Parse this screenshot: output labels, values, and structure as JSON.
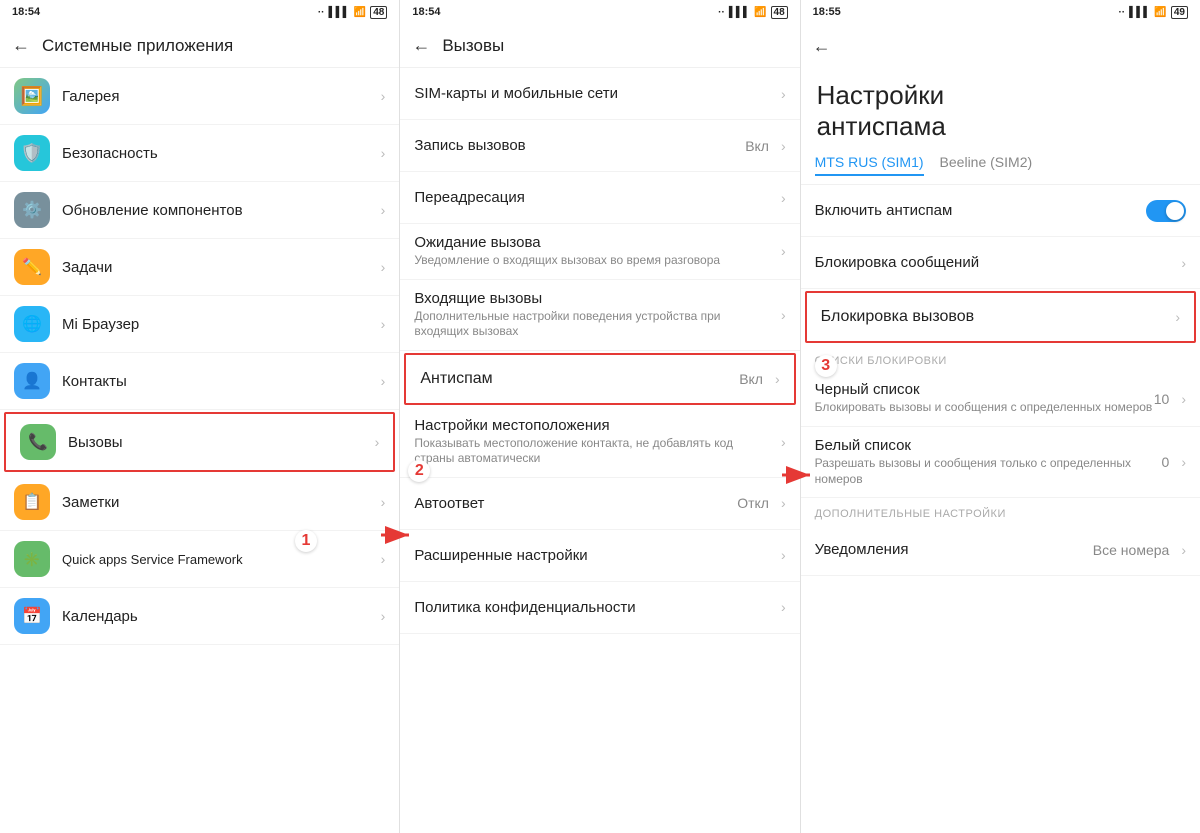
{
  "screens": [
    {
      "statusBar": {
        "time": "18:54",
        "dots": "··"
      },
      "navTitle": "Системные приложения",
      "items": [
        {
          "id": "gallery",
          "icon": "🖼️",
          "iconBg": "#e8f5e9",
          "title": "Галерея",
          "subtitle": "",
          "value": "",
          "chevron": true
        },
        {
          "id": "security",
          "icon": "🛡️",
          "iconBg": "#e3f2fd",
          "title": "Безопасность",
          "subtitle": "",
          "value": "",
          "chevron": true
        },
        {
          "id": "updater",
          "icon": "⚙️",
          "iconBg": "#fff3e0",
          "title": "Обновление компонентов",
          "subtitle": "",
          "value": "",
          "chevron": true
        },
        {
          "id": "tasks",
          "icon": "✏️",
          "iconBg": "#fff8e1",
          "title": "Задачи",
          "subtitle": "",
          "value": "",
          "chevron": true
        },
        {
          "id": "browser",
          "icon": "🌐",
          "iconBg": "#e3f2fd",
          "title": "Mi Браузер",
          "subtitle": "",
          "value": "",
          "chevron": true
        },
        {
          "id": "contacts",
          "icon": "👤",
          "iconBg": "#e8f5e9",
          "title": "Контакты",
          "subtitle": "",
          "value": "",
          "chevron": true
        },
        {
          "id": "calls",
          "icon": "📞",
          "iconBg": "#e8f5e9",
          "title": "Вызовы",
          "subtitle": "",
          "value": "",
          "chevron": true,
          "highlighted": true
        },
        {
          "id": "notes",
          "icon": "📋",
          "iconBg": "#fff8e1",
          "title": "Заметки",
          "subtitle": "",
          "value": "",
          "chevron": true
        },
        {
          "id": "quickapps",
          "icon": "✳️",
          "iconBg": "#e8f5e9",
          "title": "Quick apps Service Framework",
          "subtitle": "",
          "value": "",
          "chevron": true
        },
        {
          "id": "calendar",
          "icon": "📅",
          "iconBg": "#e3f2fd",
          "title": "Календарь",
          "subtitle": "",
          "value": "",
          "chevron": true
        }
      ],
      "annotation": "1"
    },
    {
      "statusBar": {
        "time": "18:54",
        "dots": "··"
      },
      "navTitle": "Вызовы",
      "items": [
        {
          "id": "sim",
          "icon": "",
          "title": "SIM-карты и мобильные сети",
          "subtitle": "",
          "value": "",
          "chevron": true
        },
        {
          "id": "record",
          "icon": "",
          "title": "Запись вызовов",
          "subtitle": "",
          "value": "Вкл",
          "chevron": true
        },
        {
          "id": "redirect",
          "icon": "",
          "title": "Переадресация",
          "subtitle": "",
          "value": "",
          "chevron": true
        },
        {
          "id": "wait",
          "icon": "",
          "title": "Ожидание вызова",
          "subtitle": "Уведомление о входящих вызовах во время разговора",
          "value": "",
          "chevron": true
        },
        {
          "id": "incoming",
          "icon": "",
          "title": "Входящие вызовы",
          "subtitle": "Дополнительные настройки поведения устройства при входящих вызовах",
          "value": "",
          "chevron": true
        },
        {
          "id": "antispam",
          "icon": "",
          "title": "Антиспам",
          "subtitle": "",
          "value": "Вкл",
          "chevron": true,
          "highlighted": true
        },
        {
          "id": "location",
          "icon": "",
          "title": "Настройки местоположения",
          "subtitle": "Показывать местоположение контакта, не добавлять код страны автоматически",
          "value": "",
          "chevron": true
        },
        {
          "id": "autoanswer",
          "icon": "",
          "title": "Автоответ",
          "subtitle": "",
          "value": "Откл",
          "chevron": true
        },
        {
          "id": "advanced",
          "icon": "",
          "title": "Расширенные настройки",
          "subtitle": "",
          "value": "",
          "chevron": true
        },
        {
          "id": "privacy",
          "icon": "",
          "title": "Политика конфиденциальности",
          "subtitle": "",
          "value": "",
          "chevron": true
        }
      ],
      "annotation": "2"
    },
    {
      "statusBar": {
        "time": "18:55",
        "dots": "··"
      },
      "navTitle": "",
      "largeTitle": "Настройки\nантиспама",
      "simTabs": [
        {
          "label": "MTS RUS (SIM1)",
          "active": true
        },
        {
          "label": "Beeline (SIM2)",
          "active": false
        }
      ],
      "items": [
        {
          "id": "enable-antispam",
          "title": "Включить антиспам",
          "toggle": true
        },
        {
          "id": "block-messages",
          "title": "Блокировка сообщений",
          "chevron": true
        },
        {
          "id": "block-calls",
          "title": "Блокировка вызовов",
          "chevron": true,
          "highlighted": true
        }
      ],
      "sectionBlockList": "СПИСКИ БЛОКИРОВКИ",
      "blockListItems": [
        {
          "id": "blacklist",
          "title": "Черный список",
          "subtitle": "Блокировать вызовы и сообщения с определенных номеров",
          "value": "10",
          "chevron": true
        },
        {
          "id": "whitelist",
          "title": "Белый список",
          "subtitle": "Разрешать вызовы и сообщения только с определенных номеров",
          "value": "0",
          "chevron": true
        }
      ],
      "sectionAdditional": "ДОПОЛНИТЕЛЬНЫЕ НАСТРОЙКИ",
      "additionalItems": [
        {
          "id": "notifications",
          "title": "Уведомления",
          "value": "Все номера",
          "chevron": true
        }
      ],
      "annotation": "3"
    }
  ],
  "arrows": {
    "label1": "1",
    "label2": "2",
    "label3": "3"
  },
  "iconColors": {
    "gallery": "#66bb6a",
    "security": "#29b6f6",
    "updater": "#78909c",
    "tasks": "#ffa726",
    "browser": "#29b6f6",
    "contacts": "#42a5f5",
    "calls": "#66bb6a",
    "notes": "#ffa726",
    "quickapps": "#66bb6a",
    "calendar": "#42a5f5"
  }
}
